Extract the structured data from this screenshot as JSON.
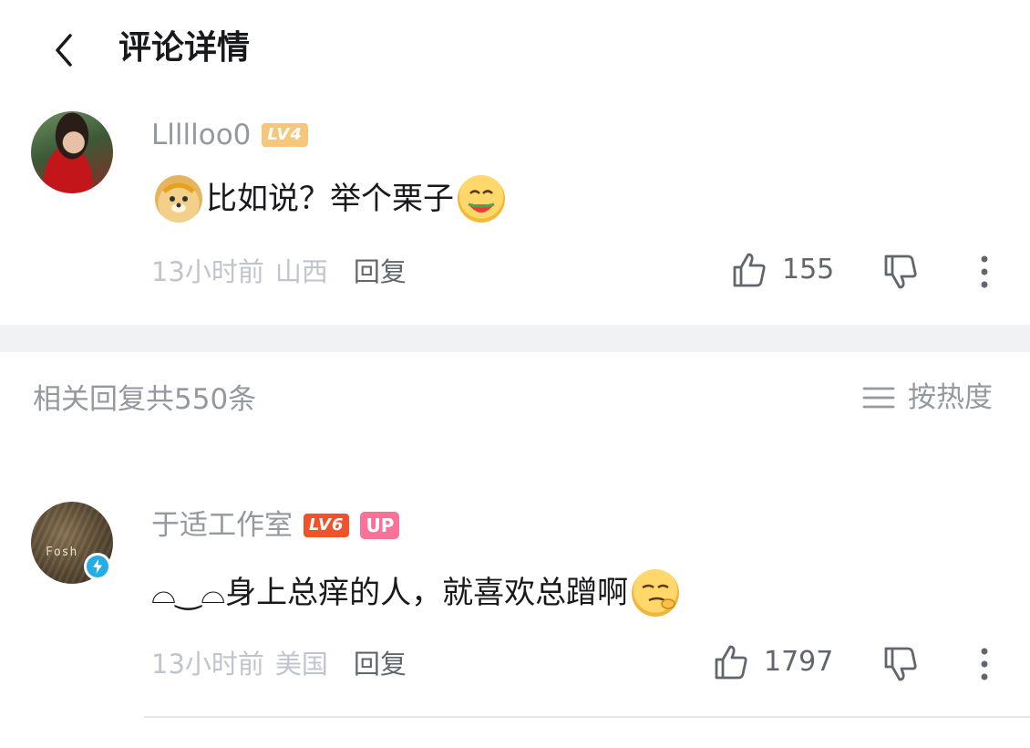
{
  "header": {
    "title": "评论详情"
  },
  "main_comment": {
    "username": "Llllloo0",
    "level": "LV4",
    "text": "比如说？举个栗子",
    "emoji_prefix": "doge-monkey-king-emoji",
    "emoji_suffix": "eating-watermelon-emoji",
    "time": "13小时前",
    "location": "山西",
    "reply_label": "回复",
    "likes": "155"
  },
  "replies_section": {
    "title": "相关回复共550条",
    "sort_label": "按热度"
  },
  "reply_comment": {
    "username": "于适工作室",
    "level": "LV6",
    "up_tag": "UP",
    "text": "⌓‿⌓身上总痒的人，就喜欢总蹭啊",
    "emoji_suffix": "smirk-emoji",
    "time": "13小时前",
    "location": "美国",
    "reply_label": "回复",
    "likes": "1797",
    "avatar_text": "Fosh"
  },
  "colors": {
    "meta": "#c0c4cc",
    "secondary": "#9499a0",
    "up_tag": "#fb7299",
    "lv4": "#f6c77a",
    "lv6": "#f0532b",
    "verify": "#23ade5"
  }
}
